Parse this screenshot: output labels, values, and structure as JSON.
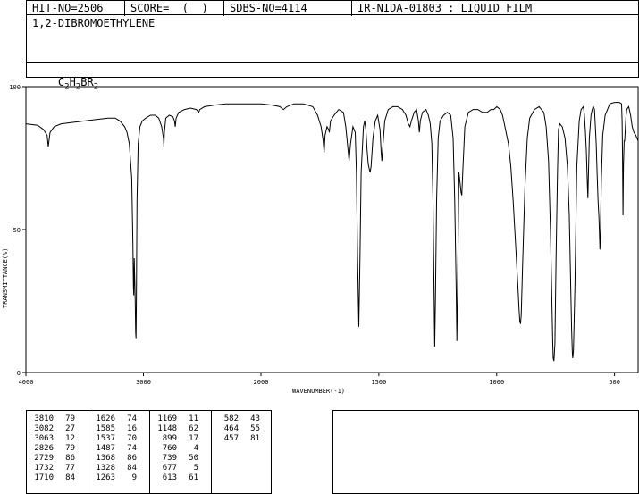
{
  "header": {
    "hit_no": "HIT-NO=2506",
    "score": "SCORE=  (  )",
    "sdbs_no": "SDBS-NO=4114",
    "ir_code": "IR-NIDA-01803 : LIQUID FILM",
    "compound_name": "1,2-DIBROMOETHYLENE",
    "formula_parts": [
      {
        "text": "C",
        "sub": "2"
      },
      {
        "text": "H",
        "sub": "2"
      },
      {
        "text": "BR",
        "sub": "2"
      }
    ]
  },
  "chart_data": {
    "type": "line",
    "title": "",
    "xlabel": "WAVENUMBER(-1)",
    "ylabel": "TRANSMITTANCE(%)",
    "xlim": [
      4000,
      400
    ],
    "ylim": [
      0,
      100
    ],
    "x_ticks": [
      4000,
      3000,
      2000,
      1500,
      1000,
      500
    ],
    "y_ticks": [
      0,
      50,
      100
    ],
    "grid": false,
    "series": [
      {
        "points": [
          [
            4000,
            87
          ],
          [
            3900,
            86.5
          ],
          [
            3850,
            85
          ],
          [
            3820,
            83
          ],
          [
            3810,
            79
          ],
          [
            3795,
            84
          ],
          [
            3760,
            86
          ],
          [
            3700,
            87
          ],
          [
            3600,
            87.5
          ],
          [
            3500,
            88
          ],
          [
            3400,
            88.5
          ],
          [
            3300,
            89
          ],
          [
            3240,
            89
          ],
          [
            3200,
            88
          ],
          [
            3160,
            86
          ],
          [
            3140,
            84
          ],
          [
            3120,
            80
          ],
          [
            3100,
            68
          ],
          [
            3090,
            45
          ],
          [
            3085,
            30
          ],
          [
            3082,
            27
          ],
          [
            3078,
            40
          ],
          [
            3070,
            25
          ],
          [
            3066,
            14
          ],
          [
            3063,
            12
          ],
          [
            3060,
            25
          ],
          [
            3055,
            60
          ],
          [
            3045,
            80
          ],
          [
            3030,
            86
          ],
          [
            3010,
            88
          ],
          [
            2980,
            89
          ],
          [
            2940,
            90
          ],
          [
            2900,
            90
          ],
          [
            2870,
            89
          ],
          [
            2845,
            86
          ],
          [
            2830,
            82
          ],
          [
            2826,
            79
          ],
          [
            2822,
            84
          ],
          [
            2810,
            89
          ],
          [
            2780,
            90
          ],
          [
            2750,
            89.5
          ],
          [
            2735,
            88
          ],
          [
            2729,
            86
          ],
          [
            2722,
            89
          ],
          [
            2700,
            91
          ],
          [
            2650,
            92
          ],
          [
            2600,
            92.5
          ],
          [
            2550,
            92
          ],
          [
            2530,
            91
          ],
          [
            2520,
            92
          ],
          [
            2480,
            93
          ],
          [
            2400,
            93.5
          ],
          [
            2300,
            94
          ],
          [
            2200,
            94
          ],
          [
            2100,
            94
          ],
          [
            2000,
            94
          ],
          [
            1950,
            93.5
          ],
          [
            1920,
            93
          ],
          [
            1905,
            92
          ],
          [
            1890,
            93
          ],
          [
            1860,
            94
          ],
          [
            1820,
            94
          ],
          [
            1780,
            93
          ],
          [
            1760,
            90
          ],
          [
            1745,
            86
          ],
          [
            1736,
            81
          ],
          [
            1732,
            77
          ],
          [
            1728,
            83
          ],
          [
            1720,
            86
          ],
          [
            1713,
            85
          ],
          [
            1710,
            84
          ],
          [
            1705,
            88
          ],
          [
            1690,
            90
          ],
          [
            1670,
            92
          ],
          [
            1650,
            91
          ],
          [
            1640,
            86
          ],
          [
            1632,
            79
          ],
          [
            1626,
            74
          ],
          [
            1620,
            80
          ],
          [
            1610,
            86
          ],
          [
            1600,
            84
          ],
          [
            1595,
            70
          ],
          [
            1590,
            40
          ],
          [
            1585,
            16
          ],
          [
            1580,
            40
          ],
          [
            1575,
            70
          ],
          [
            1565,
            86
          ],
          [
            1560,
            88
          ],
          [
            1555,
            85
          ],
          [
            1550,
            78
          ],
          [
            1545,
            73
          ],
          [
            1540,
            71
          ],
          [
            1537,
            70
          ],
          [
            1533,
            72
          ],
          [
            1525,
            82
          ],
          [
            1515,
            88
          ],
          [
            1505,
            90
          ],
          [
            1495,
            85
          ],
          [
            1490,
            77
          ],
          [
            1487,
            74
          ],
          [
            1484,
            78
          ],
          [
            1475,
            88
          ],
          [
            1460,
            92
          ],
          [
            1440,
            93
          ],
          [
            1420,
            93
          ],
          [
            1400,
            92
          ],
          [
            1385,
            90
          ],
          [
            1375,
            87
          ],
          [
            1368,
            86
          ],
          [
            1362,
            88
          ],
          [
            1350,
            91
          ],
          [
            1340,
            92
          ],
          [
            1332,
            88
          ],
          [
            1328,
            84
          ],
          [
            1324,
            88
          ],
          [
            1315,
            91
          ],
          [
            1300,
            92
          ],
          [
            1290,
            90
          ],
          [
            1282,
            87
          ],
          [
            1275,
            80
          ],
          [
            1270,
            60
          ],
          [
            1266,
            30
          ],
          [
            1263,
            9
          ],
          [
            1260,
            25
          ],
          [
            1255,
            60
          ],
          [
            1248,
            82
          ],
          [
            1240,
            88
          ],
          [
            1225,
            90
          ],
          [
            1210,
            91
          ],
          [
            1195,
            90
          ],
          [
            1185,
            82
          ],
          [
            1178,
            60
          ],
          [
            1172,
            30
          ],
          [
            1169,
            11
          ],
          [
            1166,
            30
          ],
          [
            1160,
            70
          ],
          [
            1155,
            66
          ],
          [
            1151,
            63
          ],
          [
            1148,
            62
          ],
          [
            1144,
            70
          ],
          [
            1135,
            86
          ],
          [
            1120,
            91
          ],
          [
            1100,
            92
          ],
          [
            1080,
            92
          ],
          [
            1060,
            91
          ],
          [
            1040,
            91
          ],
          [
            1025,
            92
          ],
          [
            1012,
            92
          ],
          [
            1000,
            93
          ],
          [
            985,
            92
          ],
          [
            975,
            90
          ],
          [
            965,
            86
          ],
          [
            950,
            80
          ],
          [
            940,
            72
          ],
          [
            930,
            60
          ],
          [
            920,
            45
          ],
          [
            910,
            30
          ],
          [
            905,
            22
          ],
          [
            902,
            18
          ],
          [
            899,
            17
          ],
          [
            896,
            20
          ],
          [
            890,
            38
          ],
          [
            880,
            65
          ],
          [
            870,
            82
          ],
          [
            860,
            89
          ],
          [
            840,
            92
          ],
          [
            820,
            93
          ],
          [
            800,
            91
          ],
          [
            790,
            86
          ],
          [
            780,
            74
          ],
          [
            772,
            50
          ],
          [
            766,
            25
          ],
          [
            762,
            10
          ],
          [
            760,
            5
          ],
          [
            757,
            4
          ],
          [
            753,
            10
          ],
          [
            748,
            40
          ],
          [
            742,
            70
          ],
          [
            738,
            85
          ],
          [
            732,
            87
          ],
          [
            722,
            86
          ],
          [
            710,
            82
          ],
          [
            700,
            72
          ],
          [
            692,
            55
          ],
          [
            686,
            30
          ],
          [
            682,
            15
          ],
          [
            679,
            7
          ],
          [
            677,
            5
          ],
          [
            674,
            8
          ],
          [
            668,
            30
          ],
          [
            660,
            72
          ],
          [
            650,
            88
          ],
          [
            642,
            92
          ],
          [
            632,
            93
          ],
          [
            628,
            90
          ],
          [
            624,
            85
          ],
          [
            620,
            78
          ],
          [
            617,
            70
          ],
          [
            615,
            65
          ],
          [
            613,
            61
          ],
          [
            611,
            68
          ],
          [
            607,
            82
          ],
          [
            600,
            90
          ],
          [
            595,
            92
          ],
          [
            590,
            93
          ],
          [
            585,
            92
          ],
          [
            582,
            87
          ],
          [
            578,
            80
          ],
          [
            574,
            70
          ],
          [
            570,
            60
          ],
          [
            566,
            54
          ],
          [
            564,
            49
          ],
          [
            562,
            43
          ],
          [
            560,
            48
          ],
          [
            556,
            68
          ],
          [
            550,
            83
          ],
          [
            540,
            90
          ],
          [
            520,
            94
          ],
          [
            500,
            94.5
          ],
          [
            480,
            94.5
          ],
          [
            470,
            94
          ],
          [
            468,
            88
          ],
          [
            466,
            75
          ],
          [
            464,
            55
          ],
          [
            462,
            72
          ],
          [
            459,
            81
          ],
          [
            457,
            81
          ],
          [
            452,
            89
          ],
          [
            448,
            92
          ],
          [
            440,
            93
          ],
          [
            432,
            90
          ],
          [
            425,
            86
          ],
          [
            418,
            84
          ],
          [
            410,
            83
          ],
          [
            405,
            82
          ],
          [
            400,
            81
          ]
        ]
      }
    ],
    "peak_table": [
      [
        [
          3810,
          79
        ],
        [
          3082,
          27
        ],
        [
          3063,
          12
        ],
        [
          2826,
          79
        ],
        [
          2729,
          86
        ],
        [
          1732,
          77
        ],
        [
          1710,
          84
        ]
      ],
      [
        [
          1626,
          74
        ],
        [
          1585,
          16
        ],
        [
          1537,
          70
        ],
        [
          1487,
          74
        ],
        [
          1368,
          86
        ],
        [
          1328,
          84
        ],
        [
          1263,
          9
        ]
      ],
      [
        [
          1169,
          11
        ],
        [
          1148,
          62
        ],
        [
          899,
          17
        ],
        [
          760,
          4
        ],
        [
          739,
          50
        ],
        [
          677,
          5
        ],
        [
          613,
          61
        ]
      ],
      [
        [
          582,
          43
        ],
        [
          464,
          55
        ],
        [
          457,
          81
        ]
      ]
    ]
  }
}
